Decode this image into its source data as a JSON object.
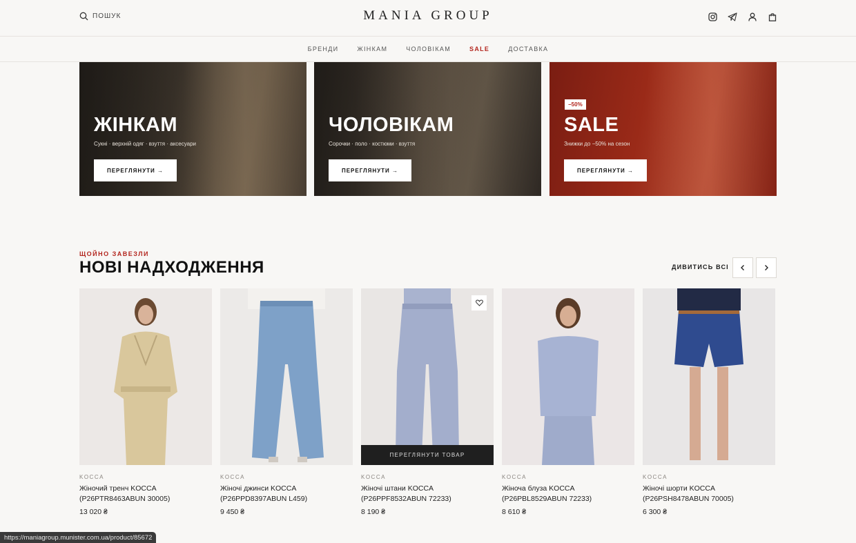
{
  "header": {
    "search_label": "ПОШУК",
    "logo": "MANIA GROUP",
    "icons": [
      "instagram-icon",
      "telegram-icon",
      "account-icon",
      "bag-icon"
    ]
  },
  "nav": [
    "БРЕНДИ",
    "ЖІНКАМ",
    "ЧОЛОВІКАМ",
    "SALE",
    "ДОСТАВКА"
  ],
  "banners": [
    {
      "title": "ЖІНКАМ",
      "subtitle": "Сукні · верхній одяг · взуття · аксесуари",
      "button": "ПЕРЕГЛЯНУТИ →"
    },
    {
      "title": "ЧОЛОВІКАМ",
      "subtitle": "Сорочки · поло · костюми · взуття",
      "button": "ПЕРЕГЛЯНУТИ →"
    },
    {
      "badge": "−50%",
      "title": "SALE",
      "subtitle": "Знижки до −50% на сезон",
      "button": "ПЕРЕГЛЯНУТИ →"
    }
  ],
  "section": {
    "eyebrow": "ЩОЙНО ЗАВЕЗЛИ",
    "title": "НОВІ НАДХОДЖЕННЯ",
    "view_all": "ДИВИТИСЬ ВСІ"
  },
  "products": [
    {
      "brand": "KOCCA",
      "name": "Жіночий тренч KOCCA (P26PTR8463ABUN 30005)",
      "price": "13 020 ₴"
    },
    {
      "brand": "KOCCA",
      "name": "Жіночі джинси KOCCA (P26PPD8397ABUN L459)",
      "price": "9 450 ₴"
    },
    {
      "brand": "KOCCA",
      "name": "Жіночі штани KOCCA (P26PPF8532ABUN 72233)",
      "price": "8 190 ₴",
      "quick_view": "ПЕРЕГЛЯНУТИ ТОВАР"
    },
    {
      "brand": "KOCCA",
      "name": "Жіноча блуза KOCCA (P26PBL8529ABUN 72233)",
      "price": "8 610 ₴"
    },
    {
      "brand": "KOCCA",
      "name": "Жіночі шорти KOCCA (P26PSH8478ABUN 70005)",
      "price": "6 300 ₴"
    }
  ],
  "status_url": "https://maniagroup.munister.com.ua/product/85672",
  "colors": {
    "accent": "#b3261e",
    "background": "#f8f7f5",
    "dark": "#1f1f1f"
  }
}
